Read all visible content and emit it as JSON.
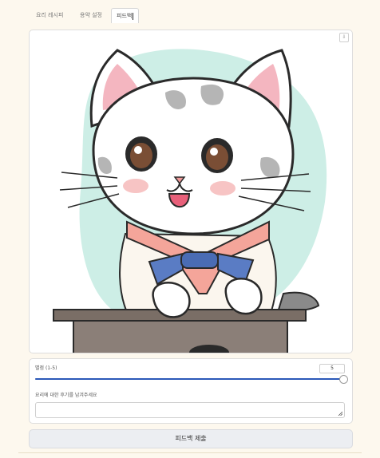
{
  "tabs": [
    {
      "label": "요리 레시피"
    },
    {
      "label": "용약 설정"
    },
    {
      "label": "피드백",
      "active": true
    }
  ],
  "image": {
    "download_icon": "download-icon"
  },
  "score": {
    "label": "별점 (1-5)",
    "value": "5",
    "fraction": 1.0
  },
  "review": {
    "label": "요리에 대한 후기를 남겨주세요",
    "value": ""
  },
  "submit": {
    "label": "피드백 제출"
  },
  "colors": {
    "accent": "#2b58b8",
    "background": "#fdf8ee"
  }
}
